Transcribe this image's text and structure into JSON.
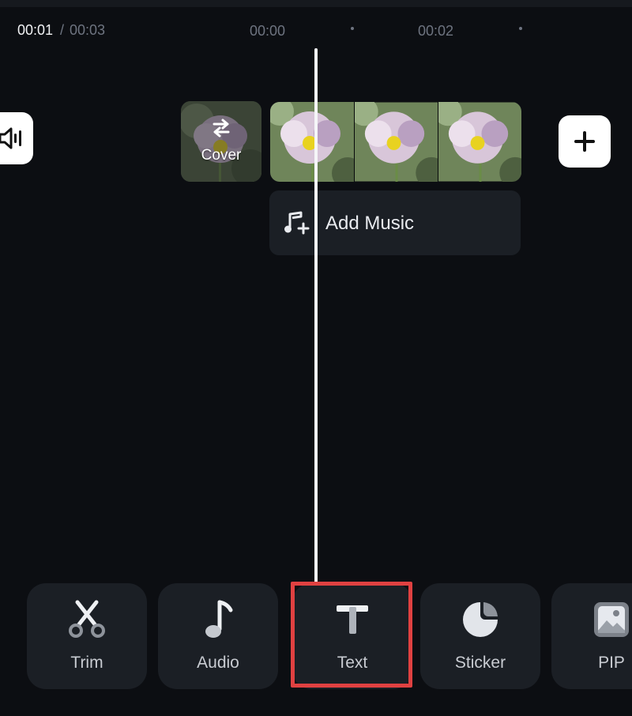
{
  "timeline": {
    "current_time": "00:01",
    "separator": "/",
    "total_time": "00:03",
    "ruler_marks": [
      "00:00",
      "00:02"
    ]
  },
  "cover": {
    "label": "Cover"
  },
  "music": {
    "label": "Add Music"
  },
  "toolbar": {
    "items": [
      {
        "label": "Trim",
        "icon": "scissors-icon"
      },
      {
        "label": "Audio",
        "icon": "music-note-icon"
      },
      {
        "label": "Text",
        "icon": "text-icon"
      },
      {
        "label": "Sticker",
        "icon": "sticker-icon"
      },
      {
        "label": "PIP",
        "icon": "image-icon"
      }
    ],
    "selected": "Text"
  },
  "colors": {
    "background": "#0c0e12",
    "panel": "#1b1f25",
    "highlight": "#e04141",
    "button_white": "#ffffff"
  }
}
